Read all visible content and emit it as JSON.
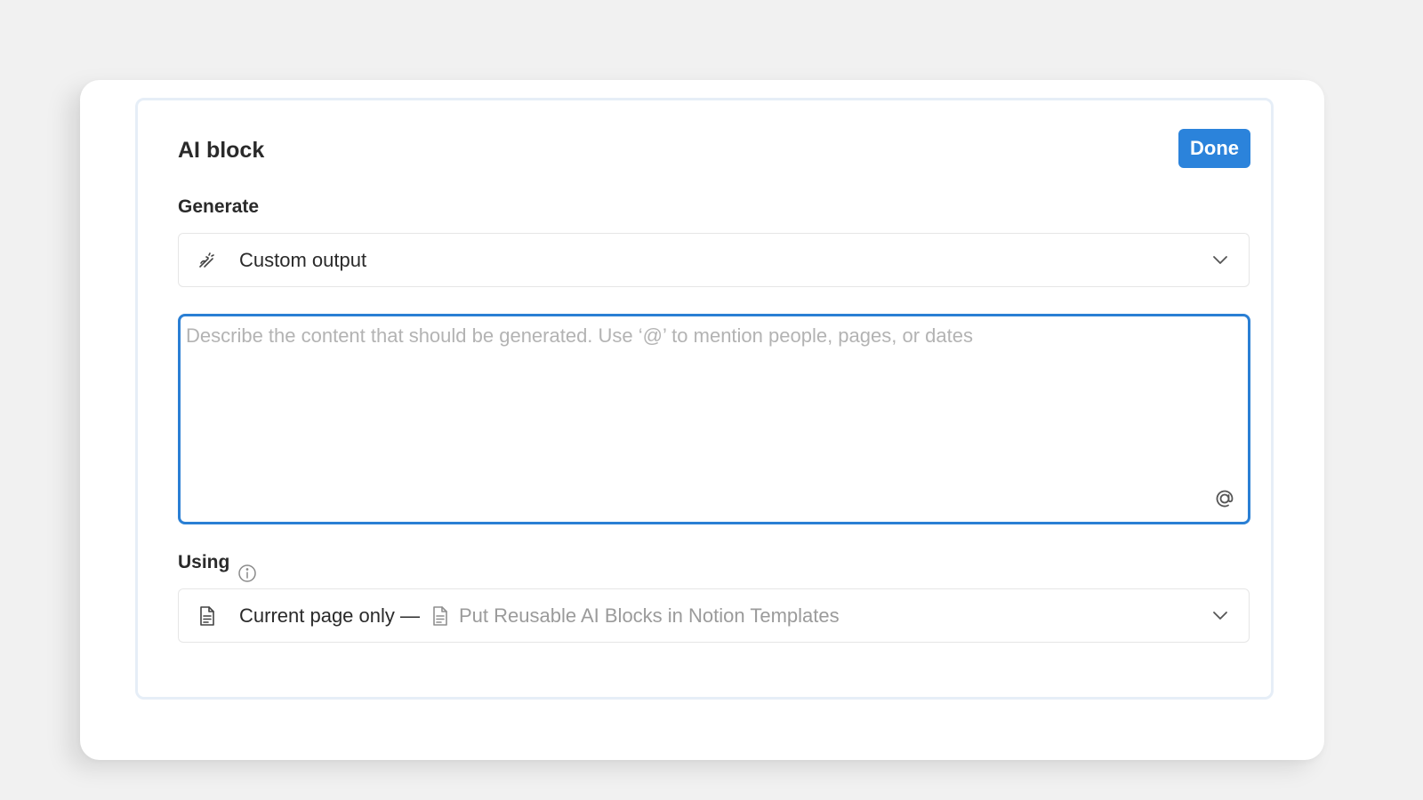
{
  "modal": {
    "title": "AI block",
    "done_label": "Done"
  },
  "generate": {
    "label": "Generate",
    "selected_option": "Custom output",
    "icon": "pen-sparkle-icon"
  },
  "prompt": {
    "value": "",
    "placeholder": "Describe the content that should be generated. Use ‘@’ to mention people, pages, or dates",
    "mention_icon": "at-sign-icon"
  },
  "using": {
    "label": "Using",
    "info_icon": "info-icon",
    "selected_option": "Current page only —",
    "page_title": "Put Reusable AI Blocks in Notion Templates",
    "icon": "document-icon"
  },
  "colors": {
    "accent": "#2b83db",
    "focus_border": "#2a7fd4",
    "background": "#f1f1f1"
  }
}
